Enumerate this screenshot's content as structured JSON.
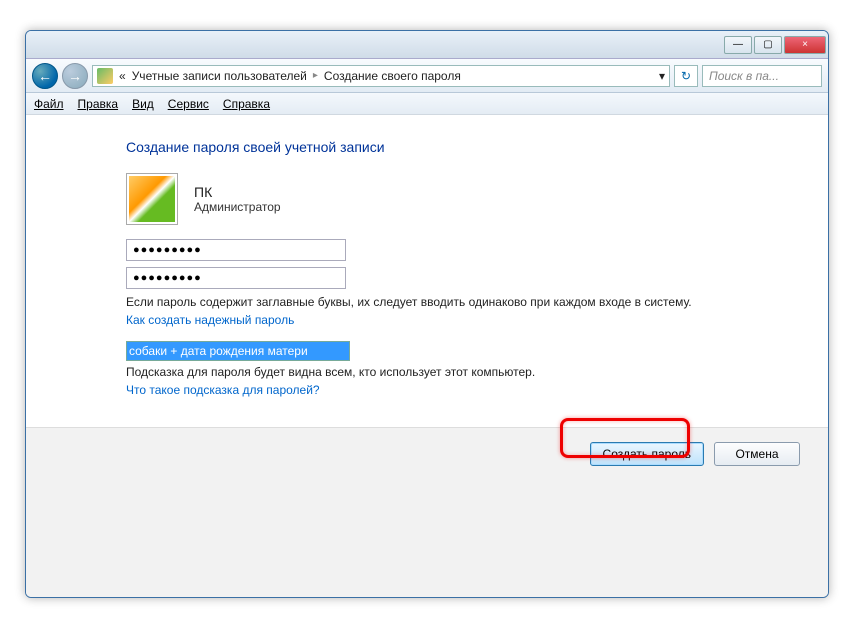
{
  "titlebar": {
    "minimize": "—",
    "maximize": "▢",
    "close": "×"
  },
  "addressbar": {
    "back": "←",
    "forward": "→",
    "prefix": "«",
    "crumb1": "Учетные записи пользователей",
    "crumb2": "Создание своего пароля",
    "sep": "▸",
    "dropdown": "▾",
    "refresh": "↻",
    "search_placeholder": "Поиск в па..."
  },
  "menu": {
    "file": "Файл",
    "edit": "Правка",
    "view": "Вид",
    "tools": "Сервис",
    "help": "Справка"
  },
  "content": {
    "heading": "Создание пароля своей учетной записи",
    "user_name": "ПК",
    "user_role": "Администратор",
    "password_mask": "●●●●●●●●●",
    "caps_warning": "Если пароль содержит заглавные буквы, их следует вводить одинаково при каждом входе в систему.",
    "strong_link": "Как создать надежный пароль",
    "hint_value": "собаки + дата рождения матери",
    "hint_visible": "Подсказка для пароля будет видна всем, кто использует этот компьютер.",
    "hint_link": "Что такое подсказка для паролей?"
  },
  "footer": {
    "create": "Создать пароль",
    "cancel": "Отмена"
  }
}
